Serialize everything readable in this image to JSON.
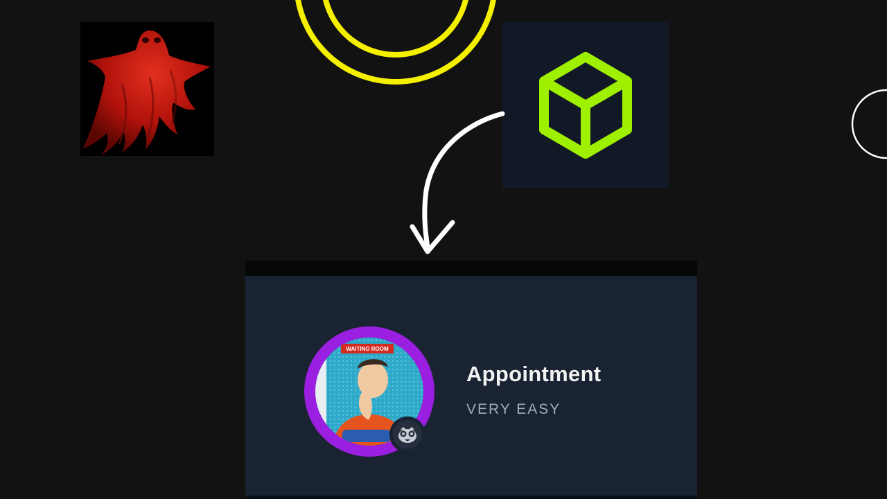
{
  "machine_card": {
    "name": "Appointment",
    "difficulty": "VERY EASY",
    "avatar_sign_text": "WAITING ROOM",
    "os_icon": "linux-penguin-icon"
  },
  "icons": {
    "ghost": "red-ghost-icon",
    "rings": "yellow-rings-icon",
    "cube": "green-cube-icon",
    "arrow": "curved-arrow-icon",
    "edge_circle": "outline-circle-icon"
  },
  "colors": {
    "background": "#121212",
    "card": "#1a2332",
    "cube_tile": "#111927",
    "cube_green": "#9fef00",
    "ring_yellow": "#f4f000",
    "avatar_ring_purple": "#9b1fe0",
    "ghost_red": "#c0160f"
  }
}
